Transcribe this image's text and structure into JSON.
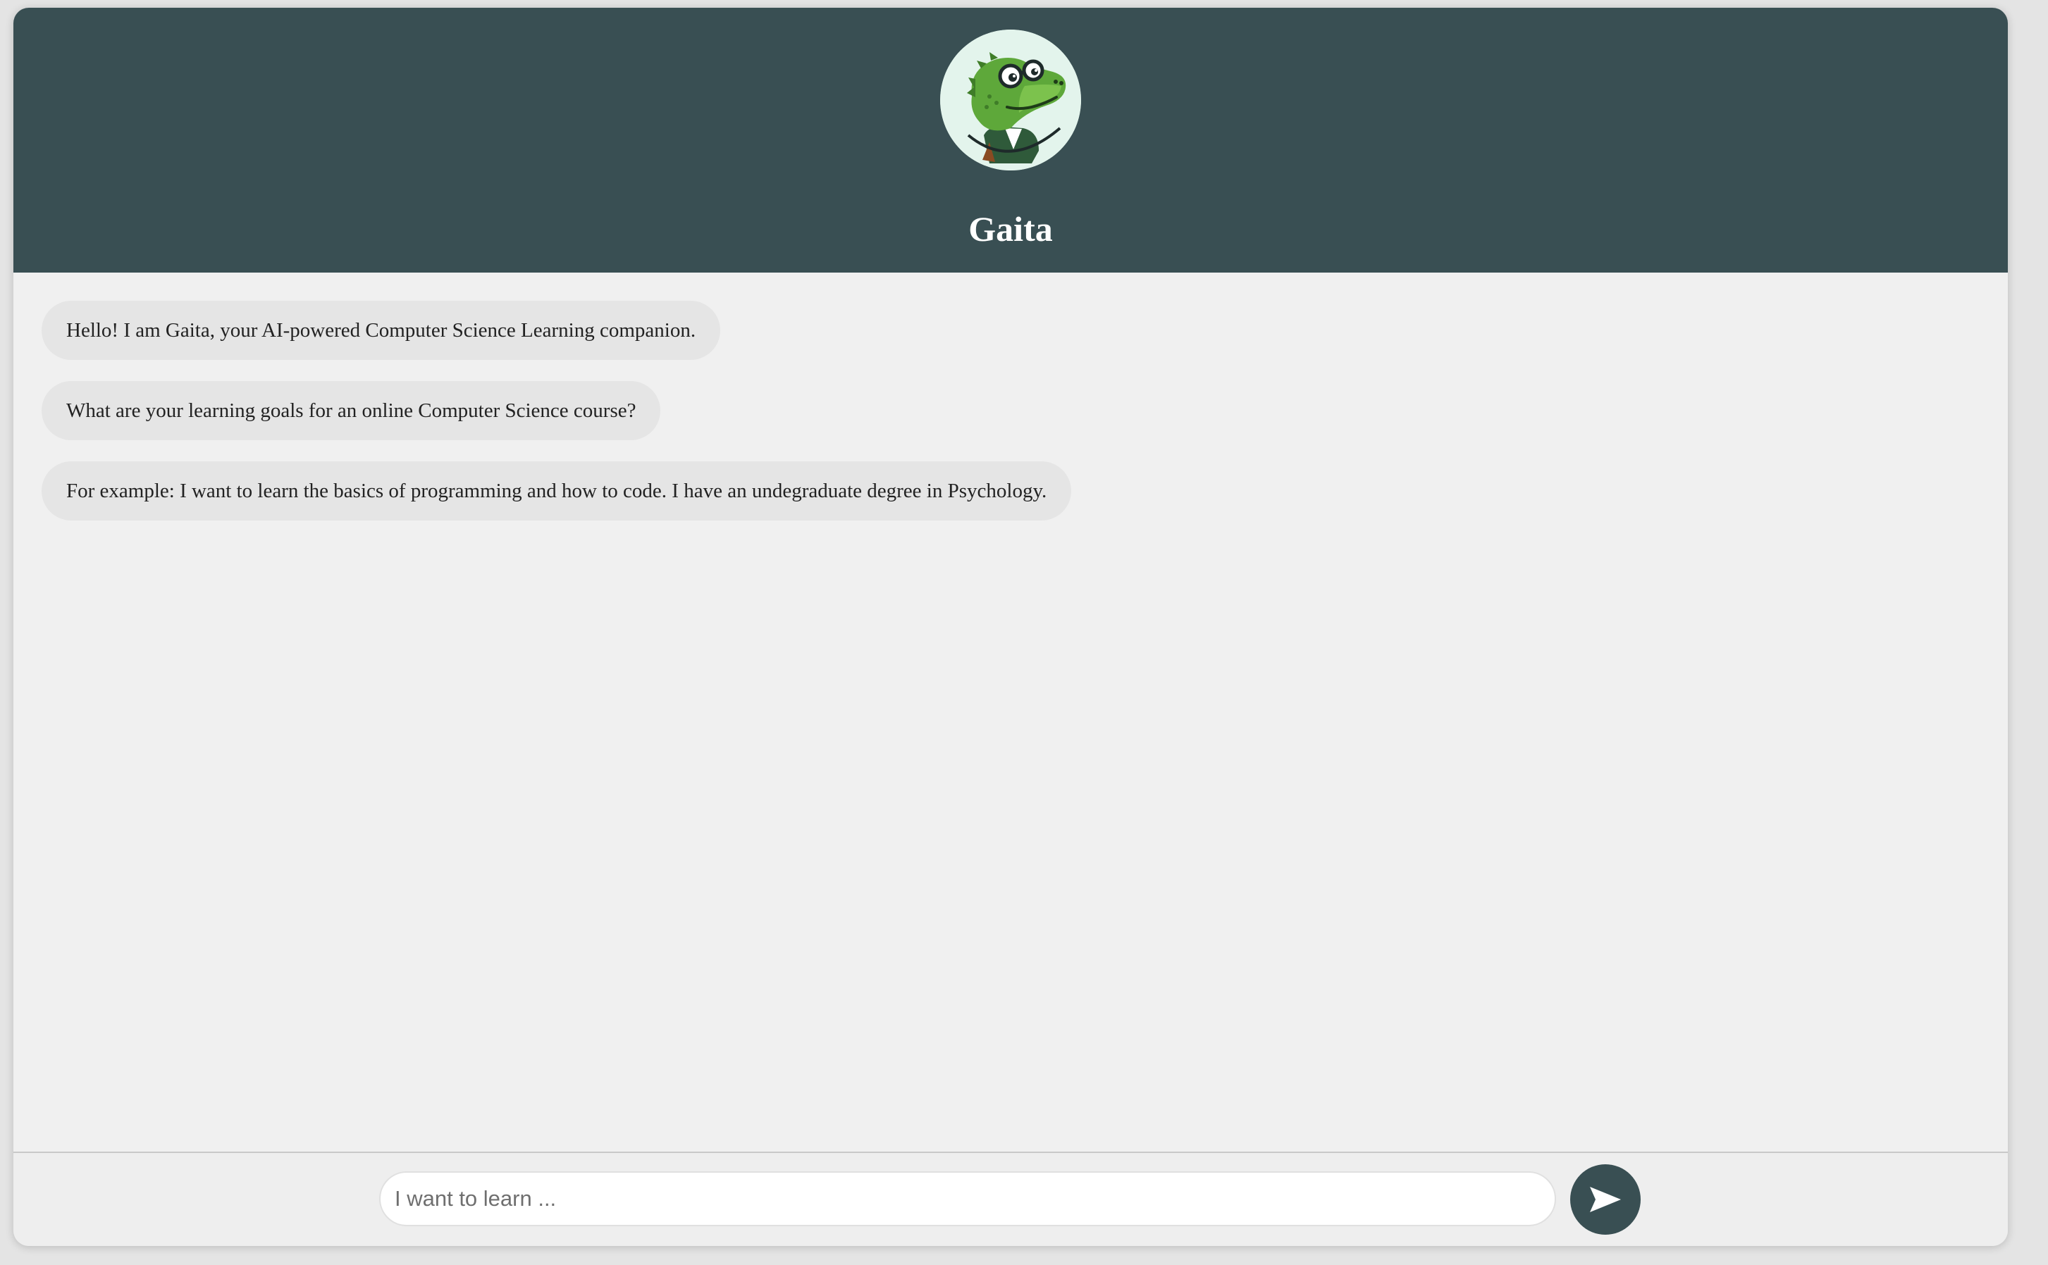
{
  "header": {
    "title": "Gaita",
    "avatar_icon": "crocodile-mascot-icon",
    "background_color": "#394f53"
  },
  "messages": [
    {
      "text": "Hello! I am Gaita, your AI-powered Computer Science Learning companion."
    },
    {
      "text": "What are your learning goals for an online Computer Science course?"
    },
    {
      "text": "For example: I want to learn the basics of programming and how to code. I have an undegraduate degree in Psychology."
    }
  ],
  "composer": {
    "placeholder": "I want to learn ...",
    "value": "",
    "send_icon": "send-arrow-icon"
  }
}
